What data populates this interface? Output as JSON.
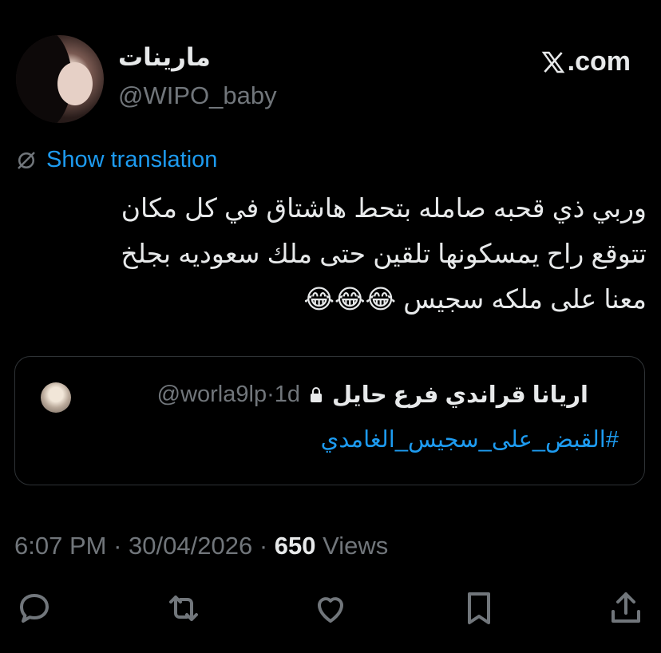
{
  "author": {
    "display_name": "مارينات",
    "handle": "@WIPO_baby"
  },
  "brand": {
    "x_mark": "𝕏",
    "domain": ".com"
  },
  "translation": {
    "label": "Show translation"
  },
  "tweet": {
    "lines": [
      "وربي ذي قحبه صامله بتحط هاشتاق في كل مكان",
      "تتوقع راح يمسكونها تلقين حتى ملك سعوديه بجلخ",
      "معنا على ملكه سجيس 😂😂😂"
    ]
  },
  "quote": {
    "name": "اريانا قراندي فرع حايل",
    "handle": "@worla9lp",
    "separator": "·",
    "age": "1d",
    "hashtag": "#القبض_على_سجيس_الغامدي"
  },
  "meta": {
    "time": "6:07 PM",
    "date": "30/04/2026",
    "views_count": "650",
    "views_label": "Views",
    "dot": "·"
  },
  "actions": {
    "icons": [
      "reply-icon",
      "retweet-icon",
      "like-icon",
      "bookmark-icon",
      "share-icon"
    ]
  },
  "colors": {
    "background": "#000000",
    "text": "#e7e9ea",
    "secondary": "#71767b",
    "accent": "#1d9bf0",
    "border": "#2f3336"
  }
}
